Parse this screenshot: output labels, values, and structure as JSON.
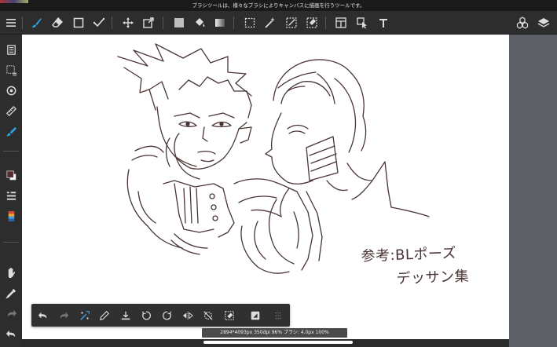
{
  "tip": {
    "text": "ブラシツールは、様々なブラシによりキャンバスに描画を行うツールです。"
  },
  "top_toolbar": {
    "items": [
      {
        "name": "menu-icon"
      },
      {
        "name": "brush-tool-icon",
        "active": true
      },
      {
        "name": "eraser-tool-icon"
      },
      {
        "name": "shape-tool-icon"
      },
      {
        "name": "correction-pen-icon"
      },
      {
        "name": "move-tool-icon"
      },
      {
        "name": "transform-tool-icon"
      },
      {
        "name": "fill-color-icon"
      },
      {
        "name": "bucket-tool-icon"
      },
      {
        "name": "gradient-tool-icon"
      },
      {
        "name": "select-tool-icon"
      },
      {
        "name": "magic-wand-icon"
      },
      {
        "name": "select-pen-icon"
      },
      {
        "name": "select-eraser-icon"
      },
      {
        "name": "panel-divide-icon"
      },
      {
        "name": "operation-tool-icon"
      },
      {
        "name": "text-tool-icon"
      },
      {
        "name": "material-icon"
      },
      {
        "name": "layers-icon"
      }
    ]
  },
  "left_toolbar": {
    "items": [
      {
        "name": "layer-panel-icon"
      },
      {
        "name": "select-icon"
      },
      {
        "name": "snap-icon"
      },
      {
        "name": "ruler-icon"
      },
      {
        "name": "brush-settings-icon"
      },
      {
        "name": "color-swatch-icon"
      },
      {
        "name": "brush-list-icon"
      },
      {
        "name": "color-palette-icon"
      },
      {
        "name": "hand-tool-icon"
      },
      {
        "name": "eyedropper-icon"
      },
      {
        "name": "redo-icon"
      },
      {
        "name": "undo-icon"
      }
    ],
    "main_color": "#5a2a2a"
  },
  "quick_bar": {
    "items": [
      {
        "name": "undo-icon"
      },
      {
        "name": "redo-icon"
      },
      {
        "name": "transform-icon"
      },
      {
        "name": "pen-icon"
      },
      {
        "name": "save-icon"
      },
      {
        "name": "rotate-left-icon"
      },
      {
        "name": "rotate-right-icon"
      },
      {
        "name": "flip-icon"
      },
      {
        "name": "snap-off-icon"
      },
      {
        "name": "clear-icon"
      },
      {
        "name": "invert-icon"
      },
      {
        "name": "grip-icon"
      }
    ]
  },
  "canvas": {
    "note_line1": "参考:BLポーズ",
    "note_line2": "デッサン集",
    "ink_color": "#4a3434"
  },
  "info": {
    "text": "2894*4093px 350dpi 96% ブラシ: 4.0px 100%"
  },
  "colors": {
    "accent": "#2fa4e7",
    "toolbar_bg": "#2d2d2d",
    "right_panel": "#5d6066"
  }
}
